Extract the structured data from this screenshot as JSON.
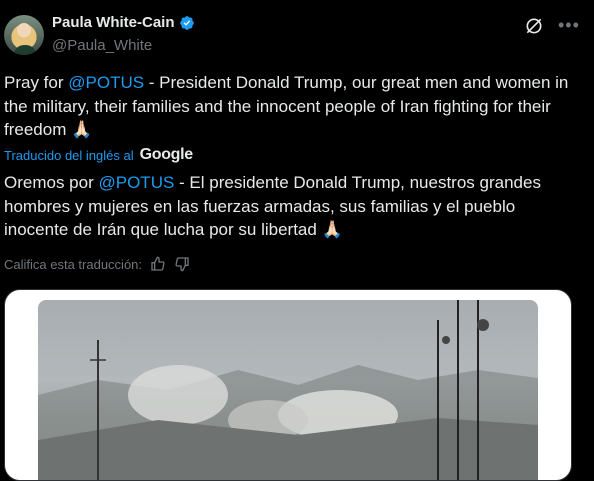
{
  "author": {
    "name": "Paula White-Cain",
    "handle": "@Paula_White"
  },
  "tweet": {
    "text_before": "Pray for ",
    "mention": "@POTUS",
    "text_after": " - President Donald Trump, our great men and women in the military, their families and the innocent people of Iran fighting for their freedom 🙏🏻"
  },
  "translation": {
    "label": "Traducido del inglés al",
    "provider": "Google",
    "text_before": "Oremos por ",
    "mention": "@POTUS",
    "text_after": " - El presidente Donald Trump, nuestros grandes hombres y mujeres en las fuerzas armadas, sus familias y el pueblo inocente de Irán que lucha por su libertad 🙏🏻",
    "rate_label": "Califica esta traducción:"
  },
  "icons": {
    "verified": "verified-badge-icon",
    "grok": "grok-icon",
    "more": "more-icon",
    "thumbs_up": "thumbs-up-icon",
    "thumbs_down": "thumbs-down-icon"
  },
  "colors": {
    "background": "#000000",
    "text": "#e7e9ea",
    "accent": "#1d9bf0",
    "muted": "#71767b"
  }
}
